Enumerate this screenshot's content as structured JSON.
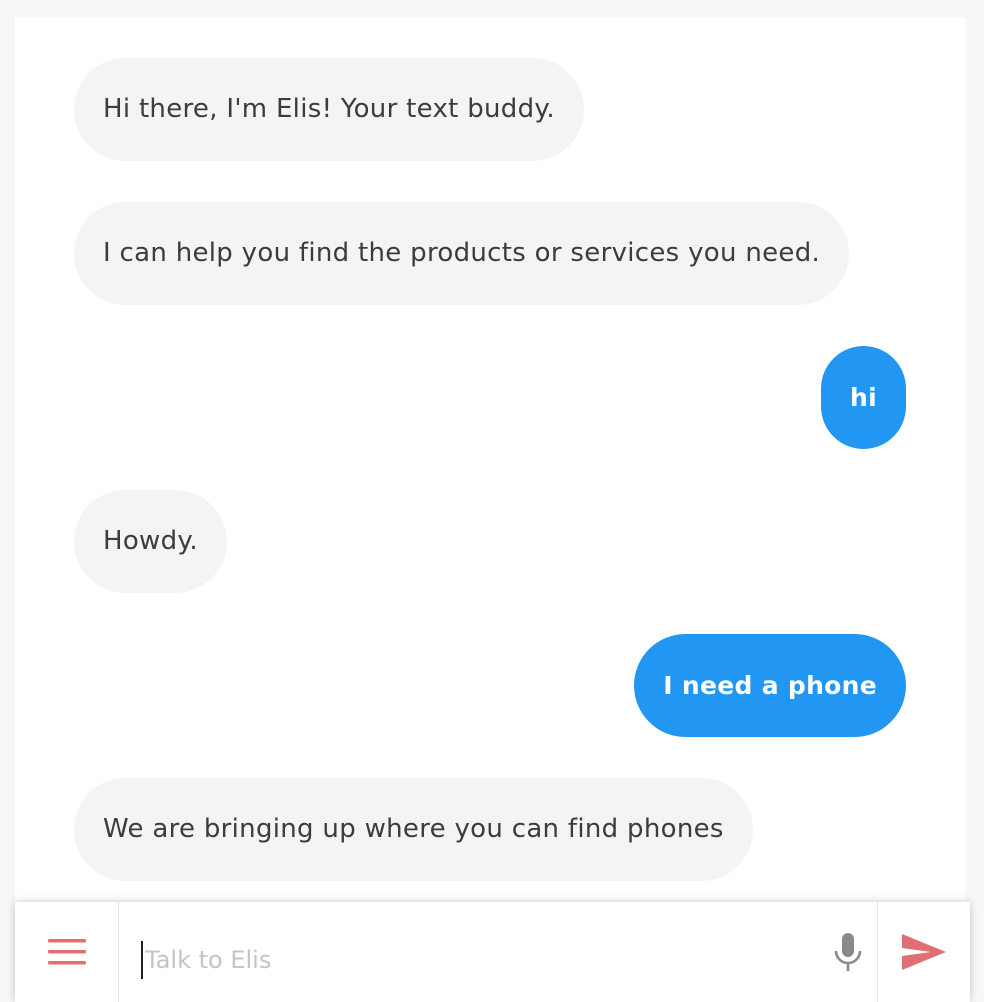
{
  "colors": {
    "bot_bubble": "#f4f4f4",
    "user_bubble": "#2196f3",
    "accent_icon": "#e06f74",
    "mic_icon": "#8a8a8a"
  },
  "messages": [
    {
      "sender": "bot",
      "text": "Hi there, I'm Elis! Your text buddy."
    },
    {
      "sender": "bot",
      "text": "I can help you find the products or services you need."
    },
    {
      "sender": "user",
      "text": "hi"
    },
    {
      "sender": "bot",
      "text": "Howdy."
    },
    {
      "sender": "user",
      "text": "I need a phone"
    },
    {
      "sender": "bot",
      "text": "We are bringing up where you can find phones"
    }
  ],
  "composer": {
    "placeholder": "Talk to Elis",
    "value": "",
    "menu_icon": "hamburger-menu-icon",
    "mic_icon": "microphone-icon",
    "send_icon": "send-arrow-icon"
  }
}
